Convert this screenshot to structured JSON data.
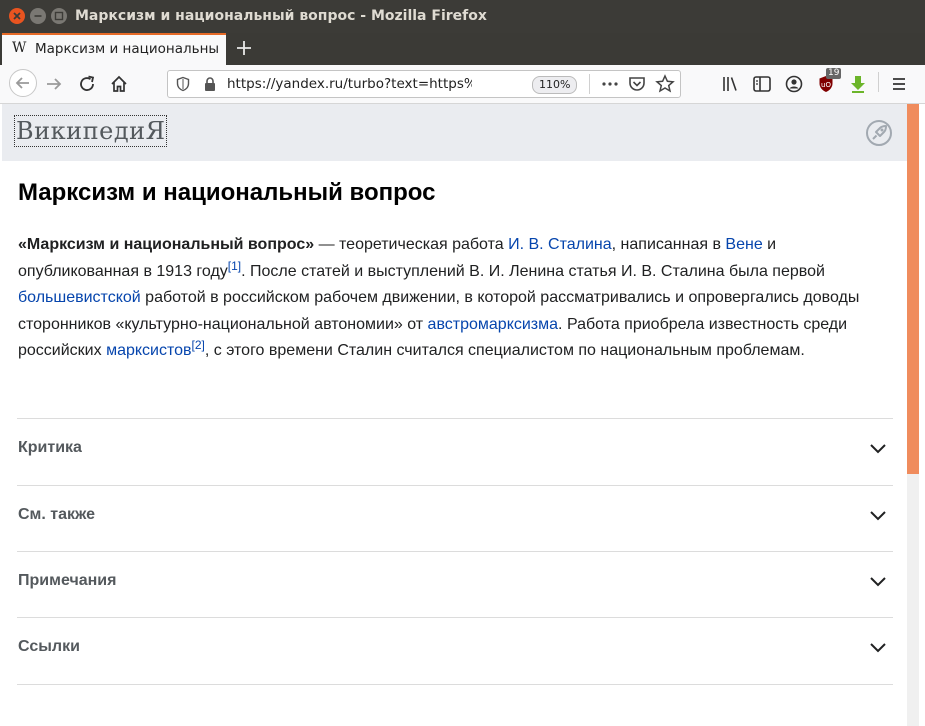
{
  "window": {
    "title": "Марксизм и национальный вопрос - Mozilla Firefox"
  },
  "tab": {
    "favicon": "W",
    "label": "Марксизм и национальный вопрос"
  },
  "navbar": {
    "url": "https://yandex.ru/turbo?text=https%3A%2F",
    "zoom": "110%",
    "badge_count": "19"
  },
  "page_header": {
    "logo": "ВикипедиЯ"
  },
  "article": {
    "title": "Марксизм и национальный вопрос",
    "lead": {
      "bold": "«Марксизм и национальный вопрос»",
      "t1": " — теоретическая работа ",
      "link1": "И. В. Сталина",
      "t2": ", написанная в ",
      "link2": "Вене",
      "t3": " и опубликованная в 1913 году",
      "ref1": "[1]",
      "t4": ". После статей и выступлений В. И. Ленина статья И. В. Сталина была первой ",
      "link3": "большевистской",
      "t5": " работой в российском рабочем движении, в которой рассматривались и опровергались доводы сторонников «культурно-национальной автономии» от ",
      "link4": "австромарксизма",
      "t6": ". Работа приобрела известность среди российских ",
      "link5": "марксистов",
      "ref2": "[2]",
      "t7": ", с этого времени Сталин считался специалистом по национальным проблемам."
    },
    "sections": [
      {
        "label": "Критика"
      },
      {
        "label": "См. также"
      },
      {
        "label": "Примечания"
      },
      {
        "label": "Ссылки"
      }
    ]
  },
  "colors": {
    "link": "#0645ad",
    "scroll_thumb": "#f08c5d",
    "tab_accent": "#e66a27",
    "header_bg": "#eaecf0"
  },
  "icons": [
    "close-icon",
    "minimize-icon",
    "maximize-icon",
    "wikipedia-favicon-icon",
    "plus-icon",
    "back-arrow-icon",
    "forward-arrow-icon",
    "reload-icon",
    "home-icon",
    "shield-icon",
    "lock-icon",
    "more-dots-icon",
    "pocket-icon",
    "star-icon",
    "library-icon",
    "sidebar-icon",
    "account-icon",
    "ublock-icon",
    "download-icon",
    "menu-icon",
    "rocket-icon",
    "chevron-down-icon"
  ]
}
